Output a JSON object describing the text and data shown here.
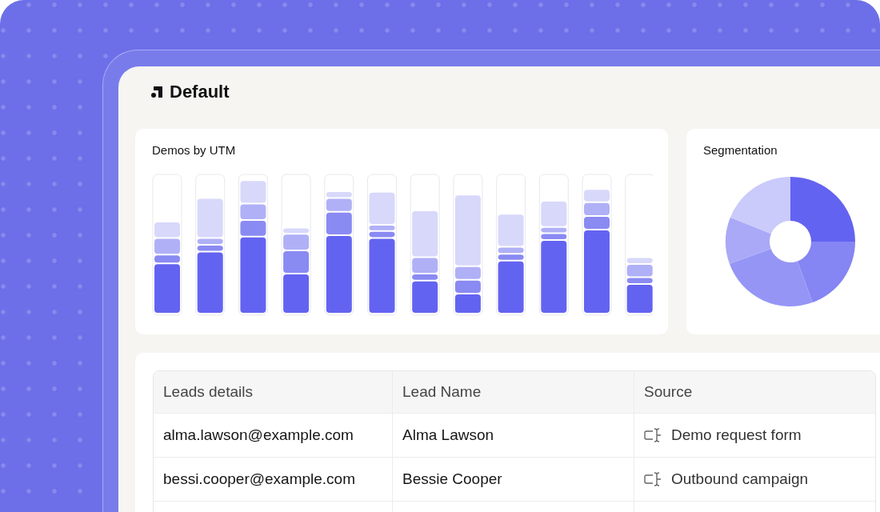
{
  "app": {
    "title": "Default"
  },
  "demos_card": {
    "title": "Demos by UTM"
  },
  "segmentation_card": {
    "title": "Segmentation"
  },
  "table": {
    "columns": [
      "Leads details",
      "Lead Name",
      "Source"
    ],
    "rows": [
      {
        "email": "alma.lawson@example.com",
        "name": "Alma Lawson",
        "source": "Demo request form"
      },
      {
        "email": "bessi.cooper@example.com",
        "name": "Bessie Cooper",
        "source": "Outbound campaign"
      }
    ]
  }
}
